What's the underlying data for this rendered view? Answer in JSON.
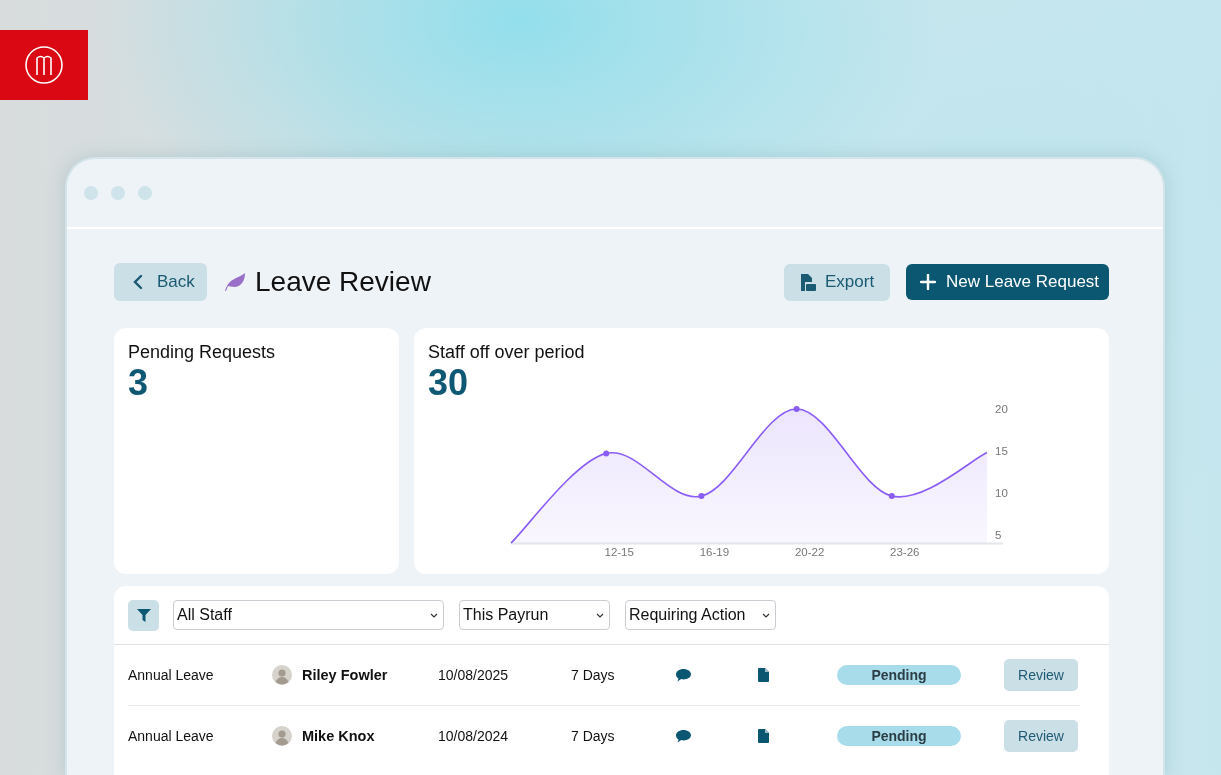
{
  "header": {
    "back_button": "Back",
    "title": "Leave Review",
    "export_button": "Export",
    "new_button": "New Leave Request"
  },
  "pending_card": {
    "title": "Pending Requests",
    "value": "3"
  },
  "staff_off_card": {
    "title": "Staff off over period",
    "value": "30",
    "chart_data": {
      "type": "area",
      "categories": [
        null,
        "12-15",
        "16-19",
        "20-22",
        "23-26",
        null
      ],
      "series": [
        {
          "color": "#8b5cf6",
          "values": [
            4,
            14.7,
            9.6,
            20,
            9.6,
            14.8
          ]
        }
      ],
      "yticks": [
        5,
        10,
        15,
        20
      ],
      "ylim": [
        4,
        20
      ]
    }
  },
  "filters": [
    {
      "value": "All Staff"
    },
    {
      "value": "This Payrun"
    },
    {
      "value": "Requiring Action"
    }
  ],
  "rows": [
    {
      "leave_type": "Annual Leave",
      "name": "Riley Fowler",
      "date": "10/08/2025",
      "duration": "7 Days",
      "status": "Pending",
      "action": "Review"
    },
    {
      "leave_type": "Annual Leave",
      "name": "Mike Knox",
      "date": "10/08/2024",
      "duration": "7 Days",
      "status": "Pending",
      "action": "Review"
    }
  ]
}
